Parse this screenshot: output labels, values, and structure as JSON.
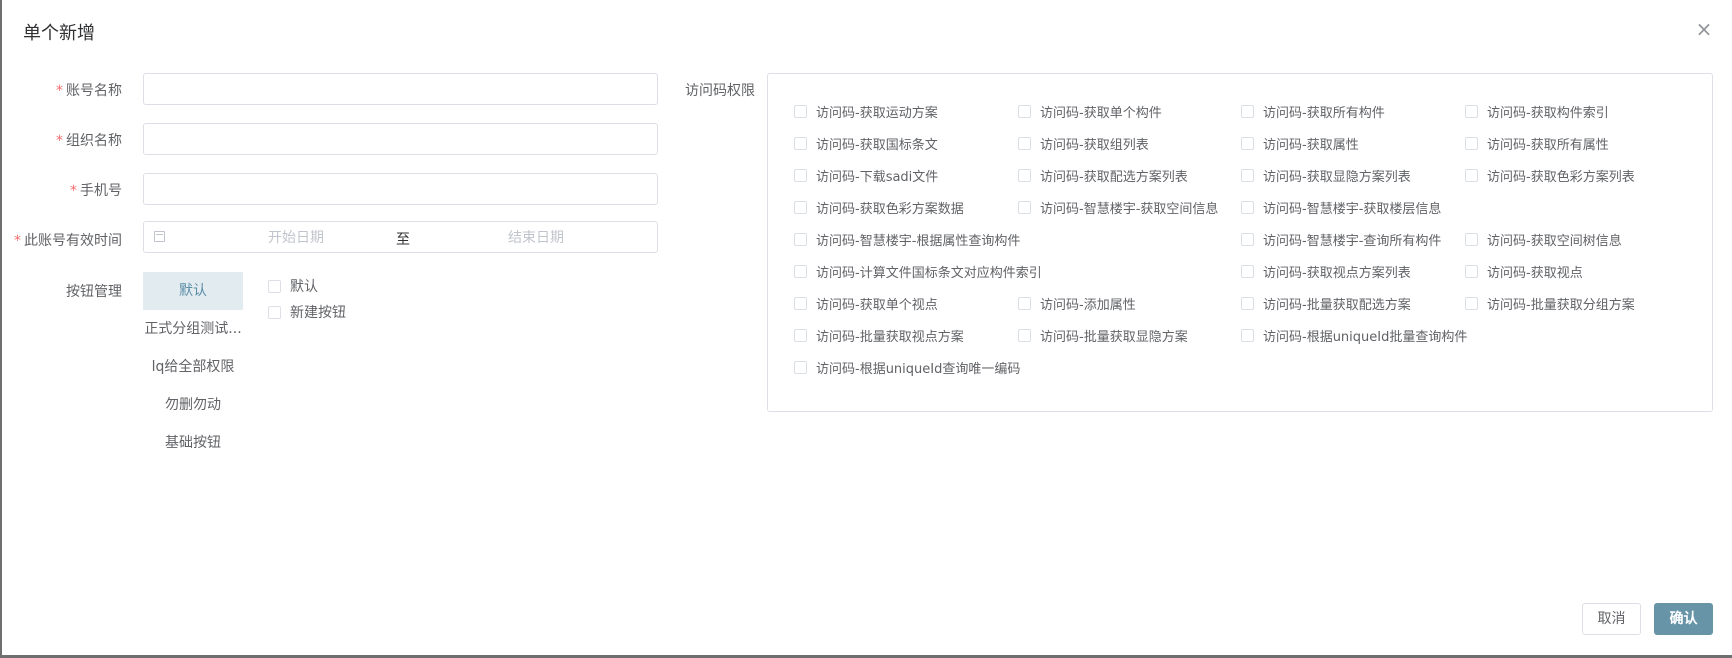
{
  "dialog": {
    "title": "单个新增",
    "close_symbol": "×"
  },
  "form": {
    "account_name": {
      "label": "账号名称",
      "value": "",
      "required_mark": "*"
    },
    "org_name": {
      "label": "组织名称",
      "value": "",
      "required_mark": "*"
    },
    "phone": {
      "label": "手机号",
      "value": "",
      "required_mark": "*"
    },
    "valid_period": {
      "label": "此账号有效时间",
      "required_mark": "*",
      "start_placeholder": "开始日期",
      "separator": "至",
      "end_placeholder": "结束日期"
    }
  },
  "button_management": {
    "label": "按钮管理",
    "groups": [
      "默认",
      "正式分组测试...",
      "lq给全部权限",
      "勿删勿动",
      "基础按钮"
    ],
    "active_group": "默认",
    "buttons": [
      "默认",
      "新建按钮"
    ]
  },
  "access_permission": {
    "label": "访问码权限",
    "items": [
      "访问码-获取运动方案",
      "访问码-获取单个构件",
      "访问码-获取所有构件",
      "访问码-获取构件索引",
      "访问码-获取国标条文",
      "访问码-获取组列表",
      "访问码-获取属性",
      "访问码-获取所有属性",
      "访问码-下载sadi文件",
      "访问码-获取配选方案列表",
      "访问码-获取显隐方案列表",
      "访问码-获取色彩方案列表",
      "访问码-获取色彩方案数据",
      "访问码-智慧楼宇-获取空间信息",
      "访问码-智慧楼宇-获取楼层信息",
      "访问码-智慧楼宇-根据属性查询构件",
      "访问码-智慧楼宇-查询所有构件",
      "访问码-获取空间树信息",
      "访问码-计算文件国标条文对应构件索引",
      "访问码-获取视点方案列表",
      "访问码-获取视点",
      "访问码-获取单个视点",
      "访问码-添加属性",
      "访问码-批量获取配选方案",
      "访问码-批量获取分组方案",
      "访问码-批量获取视点方案",
      "访问码-批量获取显隐方案",
      "访问码-根据uniqueId批量查询构件",
      "访问码-根据uniqueId查询唯一编码"
    ]
  },
  "footer": {
    "cancel_label": "取消",
    "confirm_label": "确认"
  },
  "colors": {
    "primary": "#6894a8",
    "required": "#f56c6c",
    "active_tab_bg": "#e2ecf0",
    "border": "#dcdfe6"
  }
}
